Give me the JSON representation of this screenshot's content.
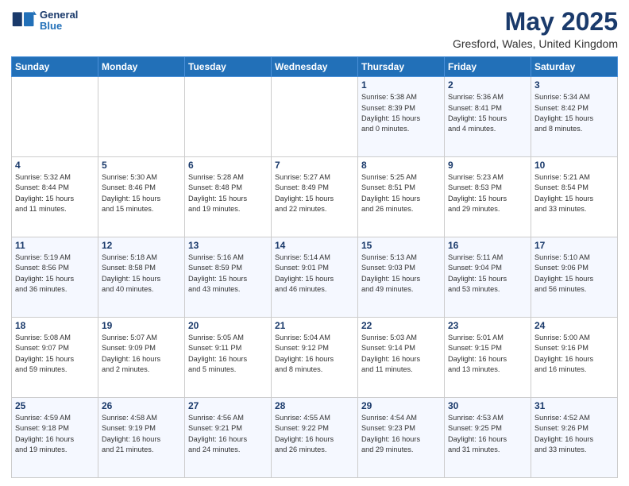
{
  "header": {
    "logo_line1": "General",
    "logo_line2": "Blue",
    "title": "May 2025",
    "subtitle": "Gresford, Wales, United Kingdom"
  },
  "weekdays": [
    "Sunday",
    "Monday",
    "Tuesday",
    "Wednesday",
    "Thursday",
    "Friday",
    "Saturday"
  ],
  "weeks": [
    [
      {
        "day": "",
        "detail": ""
      },
      {
        "day": "",
        "detail": ""
      },
      {
        "day": "",
        "detail": ""
      },
      {
        "day": "",
        "detail": ""
      },
      {
        "day": "1",
        "detail": "Sunrise: 5:38 AM\nSunset: 8:39 PM\nDaylight: 15 hours\nand 0 minutes."
      },
      {
        "day": "2",
        "detail": "Sunrise: 5:36 AM\nSunset: 8:41 PM\nDaylight: 15 hours\nand 4 minutes."
      },
      {
        "day": "3",
        "detail": "Sunrise: 5:34 AM\nSunset: 8:42 PM\nDaylight: 15 hours\nand 8 minutes."
      }
    ],
    [
      {
        "day": "4",
        "detail": "Sunrise: 5:32 AM\nSunset: 8:44 PM\nDaylight: 15 hours\nand 11 minutes."
      },
      {
        "day": "5",
        "detail": "Sunrise: 5:30 AM\nSunset: 8:46 PM\nDaylight: 15 hours\nand 15 minutes."
      },
      {
        "day": "6",
        "detail": "Sunrise: 5:28 AM\nSunset: 8:48 PM\nDaylight: 15 hours\nand 19 minutes."
      },
      {
        "day": "7",
        "detail": "Sunrise: 5:27 AM\nSunset: 8:49 PM\nDaylight: 15 hours\nand 22 minutes."
      },
      {
        "day": "8",
        "detail": "Sunrise: 5:25 AM\nSunset: 8:51 PM\nDaylight: 15 hours\nand 26 minutes."
      },
      {
        "day": "9",
        "detail": "Sunrise: 5:23 AM\nSunset: 8:53 PM\nDaylight: 15 hours\nand 29 minutes."
      },
      {
        "day": "10",
        "detail": "Sunrise: 5:21 AM\nSunset: 8:54 PM\nDaylight: 15 hours\nand 33 minutes."
      }
    ],
    [
      {
        "day": "11",
        "detail": "Sunrise: 5:19 AM\nSunset: 8:56 PM\nDaylight: 15 hours\nand 36 minutes."
      },
      {
        "day": "12",
        "detail": "Sunrise: 5:18 AM\nSunset: 8:58 PM\nDaylight: 15 hours\nand 40 minutes."
      },
      {
        "day": "13",
        "detail": "Sunrise: 5:16 AM\nSunset: 8:59 PM\nDaylight: 15 hours\nand 43 minutes."
      },
      {
        "day": "14",
        "detail": "Sunrise: 5:14 AM\nSunset: 9:01 PM\nDaylight: 15 hours\nand 46 minutes."
      },
      {
        "day": "15",
        "detail": "Sunrise: 5:13 AM\nSunset: 9:03 PM\nDaylight: 15 hours\nand 49 minutes."
      },
      {
        "day": "16",
        "detail": "Sunrise: 5:11 AM\nSunset: 9:04 PM\nDaylight: 15 hours\nand 53 minutes."
      },
      {
        "day": "17",
        "detail": "Sunrise: 5:10 AM\nSunset: 9:06 PM\nDaylight: 15 hours\nand 56 minutes."
      }
    ],
    [
      {
        "day": "18",
        "detail": "Sunrise: 5:08 AM\nSunset: 9:07 PM\nDaylight: 15 hours\nand 59 minutes."
      },
      {
        "day": "19",
        "detail": "Sunrise: 5:07 AM\nSunset: 9:09 PM\nDaylight: 16 hours\nand 2 minutes."
      },
      {
        "day": "20",
        "detail": "Sunrise: 5:05 AM\nSunset: 9:11 PM\nDaylight: 16 hours\nand 5 minutes."
      },
      {
        "day": "21",
        "detail": "Sunrise: 5:04 AM\nSunset: 9:12 PM\nDaylight: 16 hours\nand 8 minutes."
      },
      {
        "day": "22",
        "detail": "Sunrise: 5:03 AM\nSunset: 9:14 PM\nDaylight: 16 hours\nand 11 minutes."
      },
      {
        "day": "23",
        "detail": "Sunrise: 5:01 AM\nSunset: 9:15 PM\nDaylight: 16 hours\nand 13 minutes."
      },
      {
        "day": "24",
        "detail": "Sunrise: 5:00 AM\nSunset: 9:16 PM\nDaylight: 16 hours\nand 16 minutes."
      }
    ],
    [
      {
        "day": "25",
        "detail": "Sunrise: 4:59 AM\nSunset: 9:18 PM\nDaylight: 16 hours\nand 19 minutes."
      },
      {
        "day": "26",
        "detail": "Sunrise: 4:58 AM\nSunset: 9:19 PM\nDaylight: 16 hours\nand 21 minutes."
      },
      {
        "day": "27",
        "detail": "Sunrise: 4:56 AM\nSunset: 9:21 PM\nDaylight: 16 hours\nand 24 minutes."
      },
      {
        "day": "28",
        "detail": "Sunrise: 4:55 AM\nSunset: 9:22 PM\nDaylight: 16 hours\nand 26 minutes."
      },
      {
        "day": "29",
        "detail": "Sunrise: 4:54 AM\nSunset: 9:23 PM\nDaylight: 16 hours\nand 29 minutes."
      },
      {
        "day": "30",
        "detail": "Sunrise: 4:53 AM\nSunset: 9:25 PM\nDaylight: 16 hours\nand 31 minutes."
      },
      {
        "day": "31",
        "detail": "Sunrise: 4:52 AM\nSunset: 9:26 PM\nDaylight: 16 hours\nand 33 minutes."
      }
    ]
  ]
}
